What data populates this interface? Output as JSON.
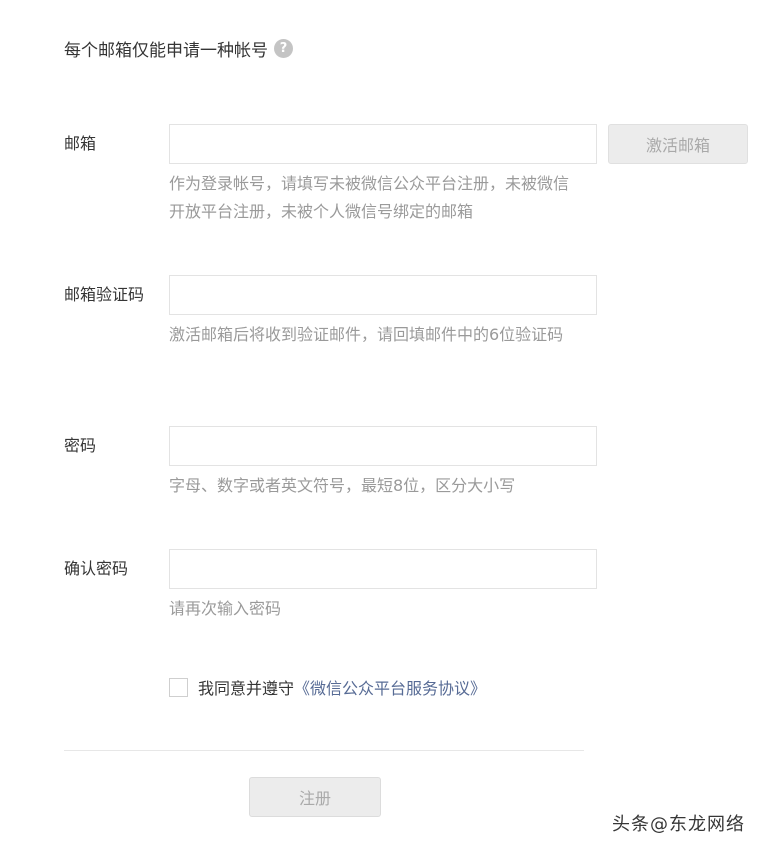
{
  "notice": {
    "text": "每个邮箱仅能申请一种帐号",
    "help_icon": "?"
  },
  "email": {
    "label": "邮箱",
    "value": "",
    "activate_button": "激活邮箱",
    "hint": "作为登录帐号，请填写未被微信公众平台注册，未被微信开放平台注册，未被个人微信号绑定的邮箱"
  },
  "code": {
    "label": "邮箱验证码",
    "value": "",
    "hint": "激活邮箱后将收到验证邮件，请回填邮件中的6位验证码"
  },
  "password": {
    "label": "密码",
    "value": "",
    "hint": "字母、数字或者英文符号，最短8位，区分大小写"
  },
  "confirm": {
    "label": "确认密码",
    "value": "",
    "hint": "请再次输入密码"
  },
  "agreement": {
    "checked": false,
    "text": "我同意并遵守",
    "link": "《微信公众平台服务协议》"
  },
  "register_button": "注册",
  "watermark": "头条@东龙网络",
  "colors": {
    "link": "#576b95",
    "hint": "#9a9a9a",
    "disabled_button": "#ececec"
  }
}
